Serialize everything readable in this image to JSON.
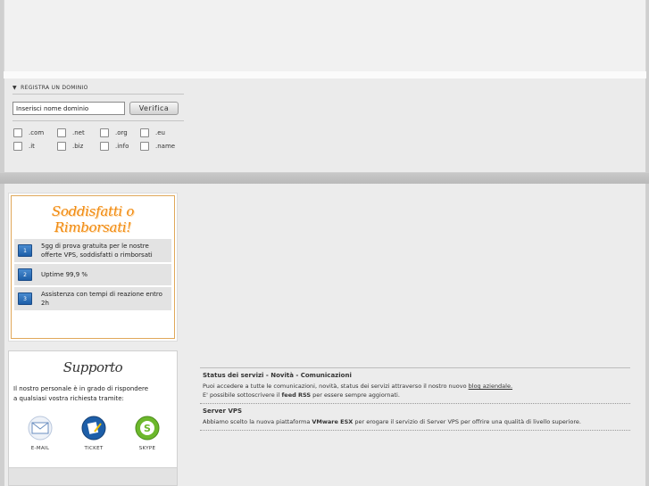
{
  "domain": {
    "heading": "Registra un dominio",
    "input_value": "Inserisci nome dominio",
    "verify_label": "Verifica",
    "tlds": [
      ".com",
      ".net",
      ".org",
      ".eu",
      ".it",
      ".biz",
      ".info",
      ".name"
    ]
  },
  "guarantee": {
    "title": "Soddisfatti o Rimborsati!",
    "items": [
      {
        "num": "1",
        "line1": "5gg di prova gratuita per le nostre",
        "line2": "offerte VPS, soddisfatti o rimborsati"
      },
      {
        "num": "2",
        "line1": "Uptime 99,9 %",
        "line2": ""
      },
      {
        "num": "3",
        "line1": "Assistenza con tempi di reazione entro 2h",
        "line2": ""
      }
    ]
  },
  "support": {
    "title": "Supporto",
    "line1": "Il nostro personale è in grado di rispondere",
    "line2": "a qualsiasi vostra richiesta tramite:",
    "icons": [
      {
        "label": "E-mail",
        "icon": "email-icon",
        "color": "#6a8ec0"
      },
      {
        "label": "Ticket",
        "icon": "ticket-icon",
        "color": "#1d5ea8"
      },
      {
        "label": "Skype",
        "icon": "skype-icon",
        "color": "#6cb82c"
      }
    ]
  },
  "news": [
    {
      "title": "Status dei servizi - Novità - Comunicazioni",
      "line1_pre": "Puoi accedere a tutte le comunicazioni, novità, status dei servizi attraverso il nostro nuovo ",
      "line1_link": "blog aziendale.",
      "line2_pre": "E' possibile sottoscrivere il ",
      "line2_bold": "feed RSS",
      "line2_post": " per essere sempre aggiornati."
    },
    {
      "title": "Server VPS",
      "line1_pre": "Abbiamo scelto la nuova piattaforma ",
      "line1_bold": "VMware ESX",
      "line1_post": " per erogare il servizio di Server VPS per offrire una qualità di livello superiore."
    }
  ]
}
